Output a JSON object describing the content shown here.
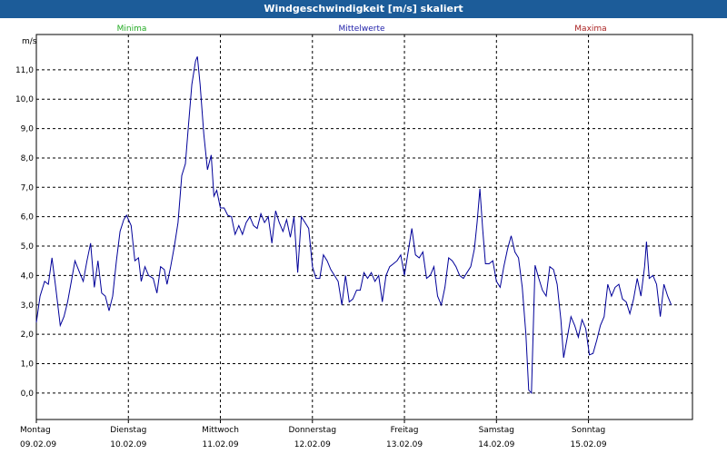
{
  "window": {
    "title": "Windgeschwindigkeit [m/s] skaliert"
  },
  "chart_data": {
    "type": "line",
    "title": "Windgeschwindigkeit [m/s] skaliert",
    "ylabel": "m/s",
    "ylim": [
      -0.9,
      12.2
    ],
    "yticks": [
      "0,0",
      "1,0",
      "2,0",
      "3,0",
      "4,0",
      "5,0",
      "6,0",
      "7,0",
      "8,0",
      "9,0",
      "10,0",
      "11,0"
    ],
    "ytick_values": [
      0,
      1,
      2,
      3,
      4,
      5,
      6,
      7,
      8,
      9,
      10,
      11
    ],
    "xlim": [
      0,
      7.13
    ],
    "grid": true,
    "legend": [
      {
        "name": "Minima",
        "color": "#22aa22"
      },
      {
        "name": "Mittelwerte",
        "color": "#2222aa"
      },
      {
        "name": "Maxima",
        "color": "#aa2222"
      }
    ],
    "xticks": [
      {
        "x": 0,
        "day": "Montag",
        "date": "09.02.09"
      },
      {
        "x": 1,
        "day": "Dienstag",
        "date": "10.02.09"
      },
      {
        "x": 2,
        "day": "Mittwoch",
        "date": "11.02.09"
      },
      {
        "x": 3,
        "day": "Donnerstag",
        "date": "12.02.09"
      },
      {
        "x": 4,
        "day": "Freitag",
        "date": "13.02.09"
      },
      {
        "x": 5,
        "day": "Samstag",
        "date": "14.02.09"
      },
      {
        "x": 6,
        "day": "Sonntag",
        "date": "15.02.09"
      }
    ],
    "series": [
      {
        "name": "Mittelwerte",
        "color": "#000099",
        "points": [
          [
            0.0,
            2.4
          ],
          [
            0.04,
            3.3
          ],
          [
            0.09,
            3.8
          ],
          [
            0.13,
            3.7
          ],
          [
            0.17,
            4.6
          ],
          [
            0.21,
            3.6
          ],
          [
            0.26,
            2.3
          ],
          [
            0.3,
            2.6
          ],
          [
            0.34,
            3.1
          ],
          [
            0.38,
            3.8
          ],
          [
            0.42,
            4.5
          ],
          [
            0.47,
            4.1
          ],
          [
            0.51,
            3.8
          ],
          [
            0.55,
            4.5
          ],
          [
            0.59,
            5.1
          ],
          [
            0.63,
            3.6
          ],
          [
            0.67,
            4.5
          ],
          [
            0.71,
            3.4
          ],
          [
            0.75,
            3.3
          ],
          [
            0.79,
            2.8
          ],
          [
            0.83,
            3.3
          ],
          [
            0.87,
            4.5
          ],
          [
            0.91,
            5.5
          ],
          [
            0.95,
            5.9
          ],
          [
            0.98,
            6.05
          ],
          [
            1.03,
            5.7
          ],
          [
            1.07,
            4.5
          ],
          [
            1.11,
            4.6
          ],
          [
            1.14,
            3.8
          ],
          [
            1.18,
            4.3
          ],
          [
            1.22,
            4.0
          ],
          [
            1.27,
            3.9
          ],
          [
            1.31,
            3.4
          ],
          [
            1.35,
            4.3
          ],
          [
            1.39,
            4.2
          ],
          [
            1.42,
            3.7
          ],
          [
            1.46,
            4.3
          ],
          [
            1.5,
            5.0
          ],
          [
            1.54,
            5.8
          ],
          [
            1.58,
            7.4
          ],
          [
            1.62,
            7.8
          ],
          [
            1.65,
            9.0
          ],
          [
            1.69,
            10.5
          ],
          [
            1.73,
            11.3
          ],
          [
            1.75,
            11.45
          ],
          [
            1.78,
            10.5
          ],
          [
            1.82,
            8.8
          ],
          [
            1.86,
            7.6
          ],
          [
            1.9,
            8.1
          ],
          [
            1.93,
            6.7
          ],
          [
            1.96,
            6.9
          ],
          [
            2.0,
            6.3
          ],
          [
            2.04,
            6.3
          ],
          [
            2.08,
            6.05
          ],
          [
            2.12,
            6.0
          ],
          [
            2.16,
            5.4
          ],
          [
            2.2,
            5.7
          ],
          [
            2.24,
            5.4
          ],
          [
            2.28,
            5.8
          ],
          [
            2.32,
            6.0
          ],
          [
            2.36,
            5.7
          ],
          [
            2.4,
            5.6
          ],
          [
            2.44,
            6.1
          ],
          [
            2.48,
            5.8
          ],
          [
            2.52,
            6.0
          ],
          [
            2.56,
            5.1
          ],
          [
            2.6,
            6.2
          ],
          [
            2.64,
            5.8
          ],
          [
            2.68,
            5.5
          ],
          [
            2.72,
            5.9
          ],
          [
            2.76,
            5.3
          ],
          [
            2.8,
            6.0
          ],
          [
            2.84,
            4.1
          ],
          [
            2.88,
            6.0
          ],
          [
            2.92,
            5.8
          ],
          [
            2.96,
            5.6
          ],
          [
            3.0,
            4.3
          ],
          [
            3.04,
            3.9
          ],
          [
            3.08,
            3.9
          ],
          [
            3.12,
            4.7
          ],
          [
            3.16,
            4.5
          ],
          [
            3.2,
            4.2
          ],
          [
            3.24,
            4.0
          ],
          [
            3.28,
            3.8
          ],
          [
            3.32,
            3.0
          ],
          [
            3.36,
            4.0
          ],
          [
            3.4,
            3.1
          ],
          [
            3.44,
            3.2
          ],
          [
            3.48,
            3.5
          ],
          [
            3.52,
            3.5
          ],
          [
            3.56,
            4.1
          ],
          [
            3.6,
            3.9
          ],
          [
            3.64,
            4.1
          ],
          [
            3.68,
            3.8
          ],
          [
            3.72,
            4.0
          ],
          [
            3.76,
            3.1
          ],
          [
            3.8,
            4.0
          ],
          [
            3.84,
            4.3
          ],
          [
            3.88,
            4.4
          ],
          [
            3.92,
            4.5
          ],
          [
            3.96,
            4.7
          ],
          [
            4.0,
            4.0
          ],
          [
            4.04,
            4.8
          ],
          [
            4.08,
            5.6
          ],
          [
            4.12,
            4.7
          ],
          [
            4.16,
            4.6
          ],
          [
            4.2,
            4.8
          ],
          [
            4.24,
            3.9
          ],
          [
            4.28,
            4.0
          ],
          [
            4.32,
            4.3
          ],
          [
            4.36,
            3.3
          ],
          [
            4.4,
            3.0
          ],
          [
            4.44,
            3.6
          ],
          [
            4.48,
            4.6
          ],
          [
            4.52,
            4.5
          ],
          [
            4.56,
            4.3
          ],
          [
            4.6,
            4.0
          ],
          [
            4.64,
            3.9
          ],
          [
            4.68,
            4.1
          ],
          [
            4.72,
            4.3
          ],
          [
            4.76,
            4.9
          ],
          [
            4.79,
            5.8
          ],
          [
            4.82,
            6.95
          ],
          [
            4.85,
            5.6
          ],
          [
            4.88,
            4.4
          ],
          [
            4.92,
            4.4
          ],
          [
            4.96,
            4.5
          ],
          [
            5.0,
            3.8
          ],
          [
            5.04,
            3.6
          ],
          [
            5.08,
            4.3
          ],
          [
            5.12,
            4.9
          ],
          [
            5.16,
            5.35
          ],
          [
            5.2,
            4.8
          ],
          [
            5.24,
            4.6
          ],
          [
            5.28,
            3.6
          ],
          [
            5.32,
            2.0
          ],
          [
            5.35,
            0.1
          ],
          [
            5.38,
            0.0
          ],
          [
            5.42,
            4.35
          ],
          [
            5.46,
            3.9
          ],
          [
            5.5,
            3.5
          ],
          [
            5.54,
            3.3
          ],
          [
            5.58,
            4.3
          ],
          [
            5.62,
            4.2
          ],
          [
            5.66,
            3.7
          ],
          [
            5.7,
            2.5
          ],
          [
            5.73,
            1.2
          ],
          [
            5.77,
            1.9
          ],
          [
            5.81,
            2.6
          ],
          [
            5.85,
            2.3
          ],
          [
            5.89,
            1.9
          ],
          [
            5.93,
            2.5
          ],
          [
            5.97,
            2.2
          ],
          [
            6.01,
            1.3
          ],
          [
            6.05,
            1.35
          ],
          [
            6.09,
            1.8
          ],
          [
            6.13,
            2.3
          ],
          [
            6.17,
            2.6
          ],
          [
            6.21,
            3.7
          ],
          [
            6.25,
            3.3
          ],
          [
            6.29,
            3.6
          ],
          [
            6.33,
            3.7
          ],
          [
            6.37,
            3.2
          ],
          [
            6.41,
            3.1
          ],
          [
            6.45,
            2.7
          ],
          [
            6.49,
            3.2
          ],
          [
            6.53,
            3.9
          ],
          [
            6.57,
            3.3
          ],
          [
            6.61,
            4.3
          ],
          [
            6.63,
            5.15
          ],
          [
            6.66,
            3.9
          ],
          [
            6.7,
            4.0
          ],
          [
            6.74,
            3.7
          ],
          [
            6.78,
            2.6
          ],
          [
            6.82,
            3.7
          ],
          [
            6.86,
            3.3
          ],
          [
            6.9,
            3.0
          ]
        ]
      }
    ]
  }
}
